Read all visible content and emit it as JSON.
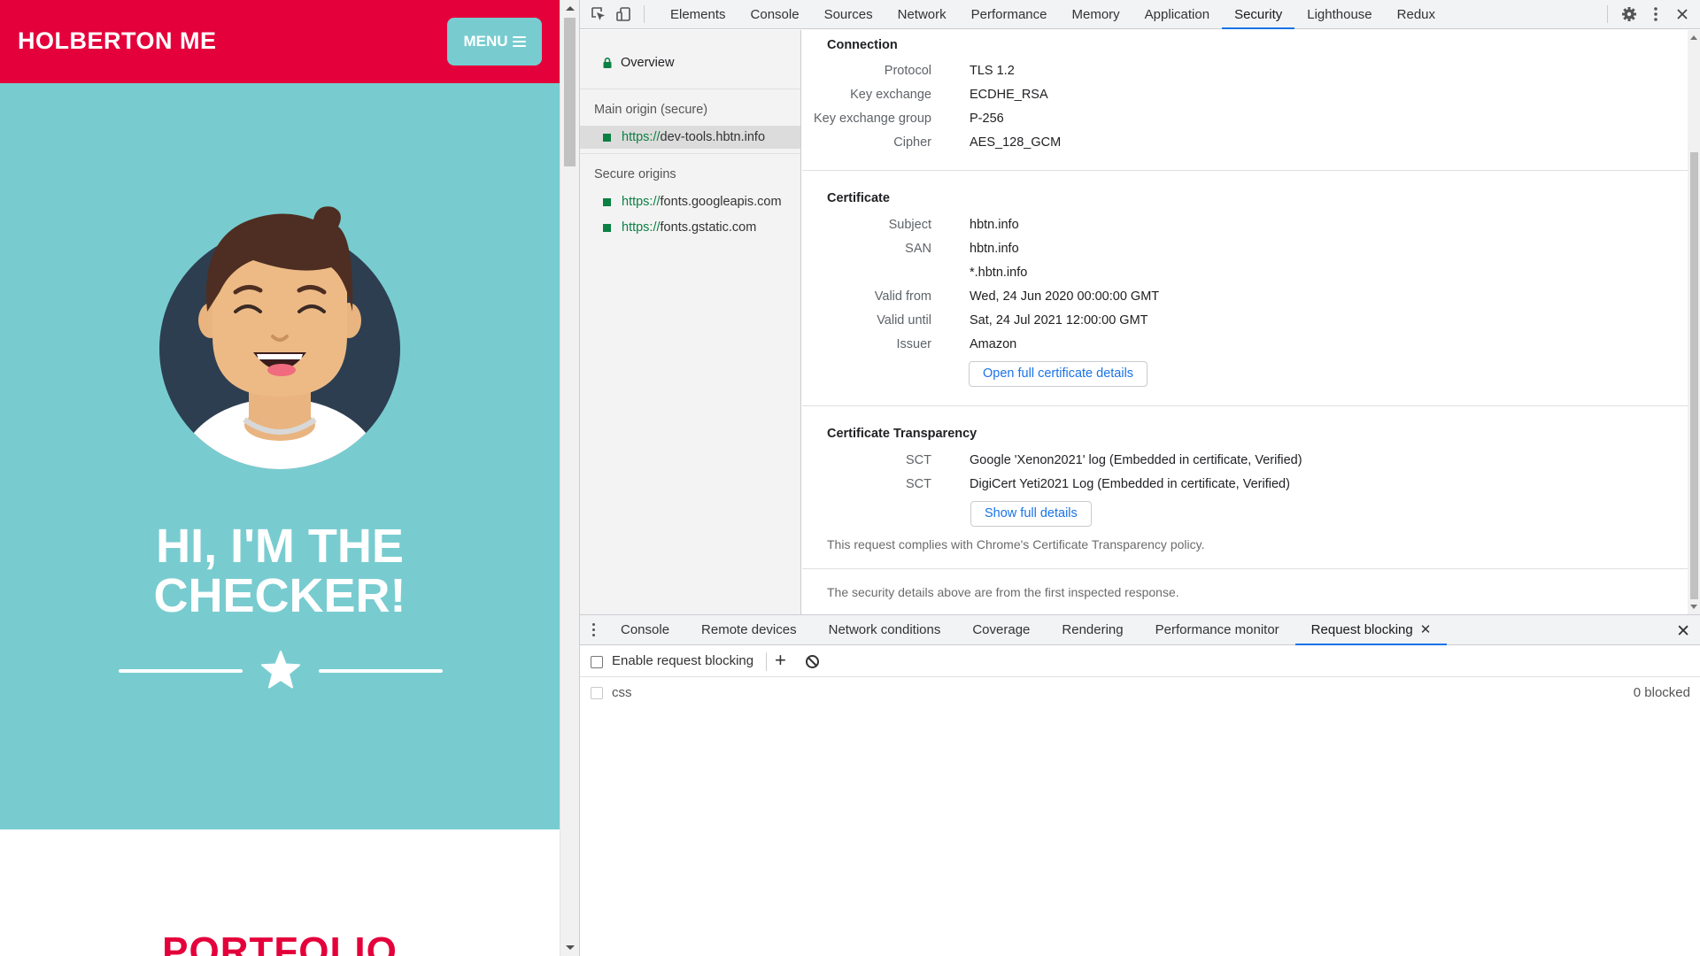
{
  "page": {
    "site_title": "HOLBERTON ME",
    "menu_label": "MENU",
    "hero_title_line1": "HI, I'M THE",
    "hero_title_line2": "CHECKER!",
    "portfolio_heading": "PORTFOLIO",
    "colors": {
      "brand_red": "#e4003b",
      "hero_teal": "#78ccd0",
      "avatar_bg": "#2d3e50"
    }
  },
  "devtools": {
    "tabs": [
      "Elements",
      "Console",
      "Sources",
      "Network",
      "Performance",
      "Memory",
      "Application",
      "Security",
      "Lighthouse",
      "Redux"
    ],
    "active_tab": "Security",
    "sidebar": {
      "overview": "Overview",
      "main_origin_heading": "Main origin (secure)",
      "main_origin": {
        "scheme": "https://",
        "host": "dev-tools.hbtn.info"
      },
      "secure_origins_heading": "Secure origins",
      "secure_origins": [
        {
          "scheme": "https://",
          "host": "fonts.googleapis.com"
        },
        {
          "scheme": "https://",
          "host": "fonts.gstatic.com"
        }
      ]
    },
    "connection": {
      "title": "Connection",
      "rows": [
        {
          "key": "Protocol",
          "value": "TLS 1.2"
        },
        {
          "key": "Key exchange",
          "value": "ECDHE_RSA"
        },
        {
          "key": "Key exchange group",
          "value": "P-256"
        },
        {
          "key": "Cipher",
          "value": "AES_128_GCM"
        }
      ]
    },
    "certificate": {
      "title": "Certificate",
      "rows": [
        {
          "key": "Subject",
          "value": "hbtn.info"
        },
        {
          "key": "SAN",
          "value": "hbtn.info"
        },
        {
          "key": "",
          "value": "*.hbtn.info"
        },
        {
          "key": "Valid from",
          "value": "Wed, 24 Jun 2020 00:00:00 GMT"
        },
        {
          "key": "Valid until",
          "value": "Sat, 24 Jul 2021 12:00:00 GMT"
        },
        {
          "key": "Issuer",
          "value": "Amazon"
        }
      ],
      "button": "Open full certificate details"
    },
    "transparency": {
      "title": "Certificate Transparency",
      "rows": [
        {
          "key": "SCT",
          "value": "Google 'Xenon2021' log (Embedded in certificate, Verified)"
        },
        {
          "key": "SCT",
          "value": "DigiCert Yeti2021 Log (Embedded in certificate, Verified)"
        }
      ],
      "button": "Show full details",
      "note": "This request complies with Chrome's Certificate Transparency policy."
    },
    "footer_note": "The security details above are from the first inspected response.",
    "drawer": {
      "tabs": [
        "Console",
        "Remote devices",
        "Network conditions",
        "Coverage",
        "Rendering",
        "Performance monitor",
        "Request blocking"
      ],
      "active_tab": "Request blocking",
      "enable_label": "Enable request blocking",
      "patterns": [
        {
          "pattern": "css",
          "count": "0 blocked"
        }
      ]
    },
    "colors": {
      "accent": "#1a73e8",
      "secure_green": "#0b8043"
    }
  }
}
